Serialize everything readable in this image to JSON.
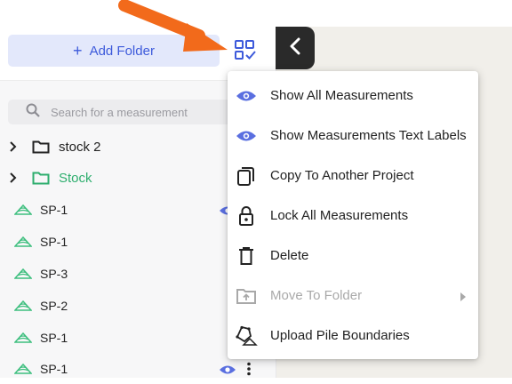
{
  "sidebar": {
    "add_folder_label": "Add Folder",
    "search": {
      "placeholder": "Search for a measurement",
      "value": ""
    },
    "folders": [
      {
        "label": "stock 2",
        "color": "#222222"
      },
      {
        "label": "Stock",
        "color": "#2eae6e"
      }
    ],
    "measurements": [
      {
        "label": "SP-1"
      },
      {
        "label": "SP-1"
      },
      {
        "label": "SP-3"
      },
      {
        "label": "SP-2"
      },
      {
        "label": "SP-1"
      },
      {
        "label": "SP-1"
      }
    ]
  },
  "menu": {
    "items": [
      {
        "label": "Show All Measurements",
        "icon": "eye-icon",
        "enabled": true
      },
      {
        "label": "Show Measurements Text Labels",
        "icon": "eye-icon",
        "enabled": true
      },
      {
        "label": "Copy To Another Project",
        "icon": "copy-icon",
        "enabled": true
      },
      {
        "label": "Lock All Measurements",
        "icon": "lock-icon",
        "enabled": true
      },
      {
        "label": "Delete",
        "icon": "trash-icon",
        "enabled": true
      },
      {
        "label": "Move To Folder",
        "icon": "folder-move-icon",
        "enabled": false,
        "has_submenu": true
      },
      {
        "label": "Upload Pile Boundaries",
        "icon": "pile-boundary-icon",
        "enabled": true
      }
    ]
  },
  "colors": {
    "accent": "#3d5adb",
    "eye": "#5a6fe0",
    "folder_green": "#2eae6e",
    "pile_green": "#3fbf7f",
    "annotation_arrow": "#f26a1b",
    "collapse_bg": "#2a2a2a"
  }
}
